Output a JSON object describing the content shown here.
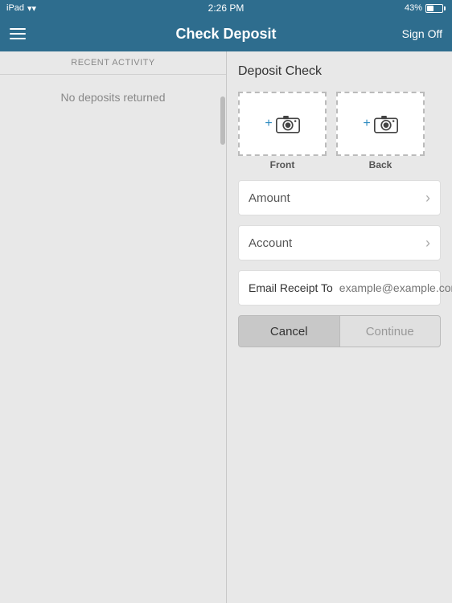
{
  "statusBar": {
    "device": "iPad",
    "time": "2:26 PM",
    "battery": "43%",
    "wifi": true
  },
  "header": {
    "title": "Check Deposit",
    "signOff": "Sign Off"
  },
  "leftPanel": {
    "sectionLabel": "RECENT ACTIVITY",
    "emptyMessage": "No deposits returned"
  },
  "rightPanel": {
    "sectionTitle": "Deposit Check",
    "frontLabel": "Front",
    "backLabel": "Back",
    "amountLabel": "Amount",
    "accountLabel": "Account",
    "emailReceiptLabel": "Email Receipt To",
    "emailPlaceholder": "example@example.com",
    "cancelLabel": "Cancel",
    "continueLabel": "Continue"
  }
}
